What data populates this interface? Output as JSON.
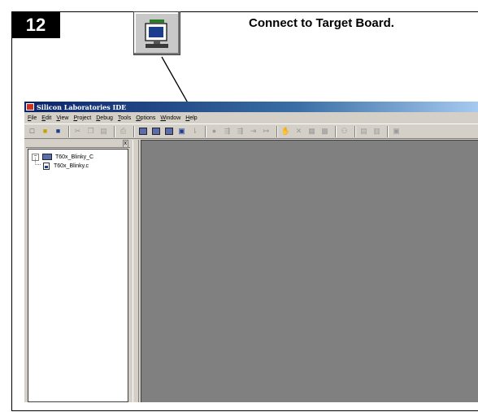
{
  "step": {
    "number": "12",
    "instruction": "Connect to Target Board."
  },
  "callout_icon": "connect-icon",
  "ide": {
    "title": "Silicon Laboratories IDE",
    "menu": [
      "File",
      "Edit",
      "View",
      "Project",
      "Debug",
      "Tools",
      "Options",
      "Window",
      "Help"
    ],
    "panel_close_label": "x",
    "project": {
      "expander": "−",
      "name": "T60x_Blinky_C",
      "files": [
        "T60x_Blinky.c"
      ]
    }
  },
  "icons": {
    "new": "new-file-icon",
    "open": "open-folder-icon",
    "save": "save-icon",
    "cut": "cut-icon",
    "copy": "copy-icon",
    "paste": "paste-icon",
    "print": "print-icon",
    "connect": "connect-icon",
    "go": "go-icon"
  }
}
